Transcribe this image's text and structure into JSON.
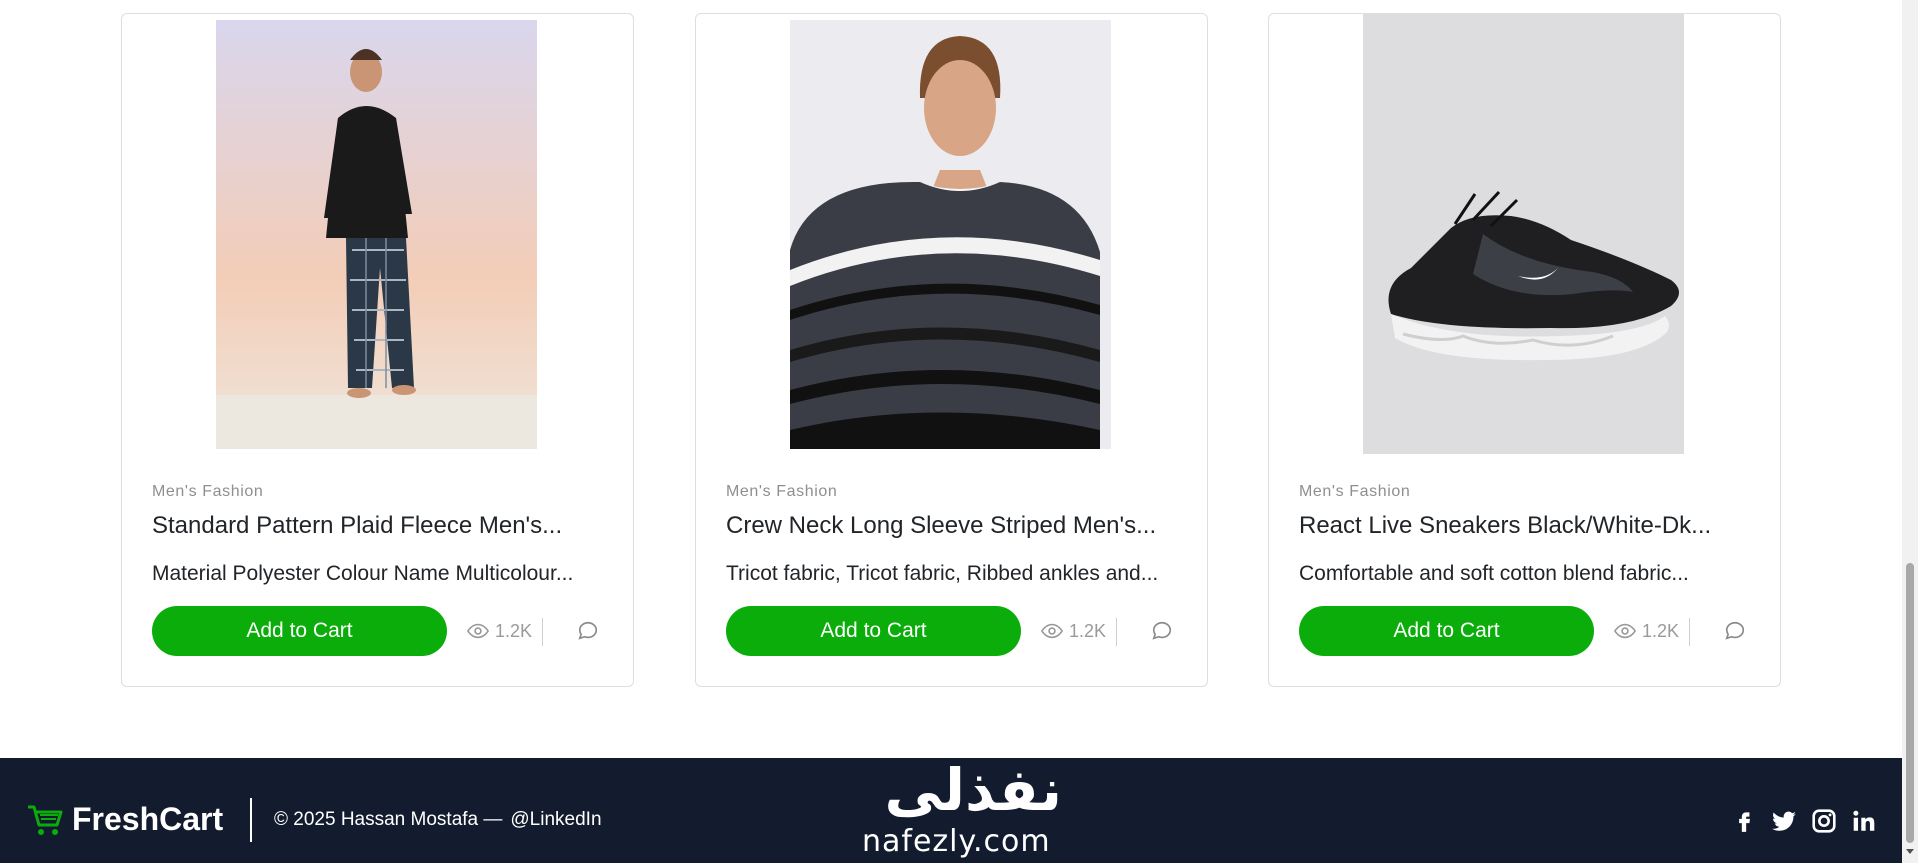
{
  "products": [
    {
      "category": "Men's Fashion",
      "title": "Standard Pattern Plaid Fleece Men's...",
      "description": "Material Polyester Colour Name Multicolour...",
      "button_label": "Add to Cart",
      "views": "1.2K",
      "image_subject": "man in black sweater and plaid pants"
    },
    {
      "category": "Men's Fashion",
      "title": "Crew Neck Long Sleeve Striped Men's...",
      "description": "Tricot fabric, Tricot fabric, Ribbed ankles and...",
      "button_label": "Add to Cart",
      "views": "1.2K",
      "image_subject": "man in striped sweater"
    },
    {
      "category": "Men's Fashion",
      "title": "React Live Sneakers Black/White-Dk...",
      "description": "Comfortable and soft cotton blend fabric...",
      "button_label": "Add to Cart",
      "views": "1.2K",
      "image_subject": "black and white sneaker"
    }
  ],
  "footer": {
    "brand_name": "FreshCart",
    "copyright": "© 2025 Hassan Mostafa —",
    "link_label": "@LinkedIn",
    "watermark_arabic": "نفذلي",
    "watermark_latin": "nafezly.com",
    "social_icons": [
      "facebook-icon",
      "twitter-icon",
      "instagram-icon",
      "linkedin-icon"
    ]
  },
  "colors": {
    "accent": "#0aad0a",
    "footer_bg": "#131c2f"
  }
}
